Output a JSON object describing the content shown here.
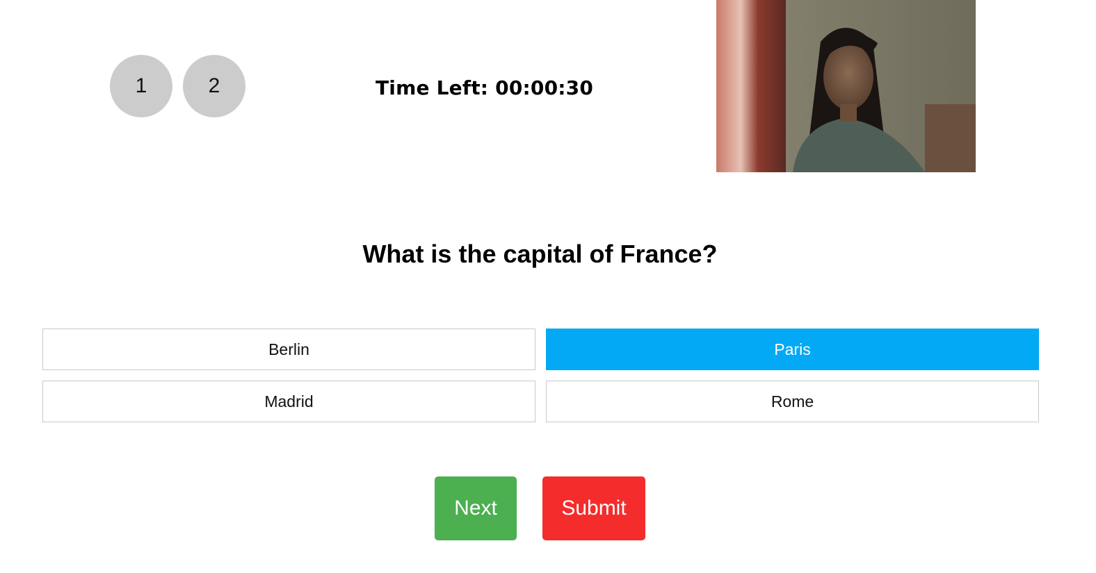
{
  "question_nav": [
    {
      "label": "1"
    },
    {
      "label": "2"
    }
  ],
  "timer": {
    "text": "Time Left: 00:00:30"
  },
  "webcam": {
    "icon": "webcam-feed"
  },
  "question": {
    "text": "What is the capital of France?"
  },
  "options": [
    {
      "label": "Berlin",
      "selected": false
    },
    {
      "label": "Paris",
      "selected": true
    },
    {
      "label": "Madrid",
      "selected": false
    },
    {
      "label": "Rome",
      "selected": false
    }
  ],
  "actions": {
    "next_label": "Next",
    "submit_label": "Submit"
  },
  "colors": {
    "selected": "#03a9f4",
    "next": "#4caf50",
    "submit": "#f42c2c",
    "nav_circle": "#cccccc"
  }
}
